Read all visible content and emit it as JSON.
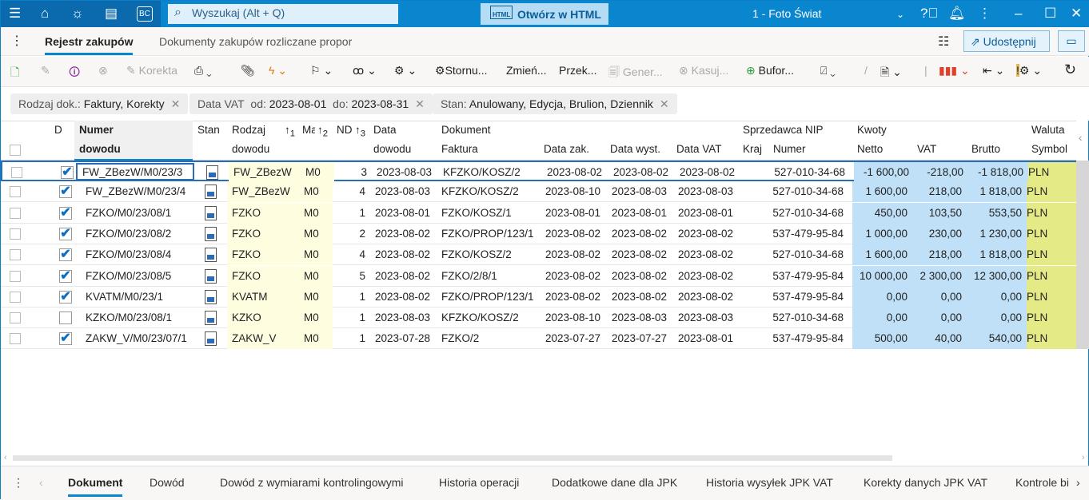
{
  "topbar": {
    "search_placeholder": "Wyszukaj (Alt + Q)",
    "open_html": "Otwórz w HTML",
    "company": "1 - Foto Świat",
    "bc": "BC"
  },
  "tabs": {
    "active": "Rejestr zakupów",
    "second": "Dokumenty zakupów rozliczane propor",
    "share": "Udostępnij"
  },
  "toolbar": {
    "korekta": "Korekta",
    "stornu": "Stornu...",
    "zmien": "Zmień...",
    "przek": "Przek...",
    "gener": "Gener...",
    "kasuj": "Kasuj...",
    "bufor": "Bufor..."
  },
  "filters": [
    {
      "label": "Rodzaj dok.:",
      "value": "Faktury, Korekty"
    },
    {
      "label": "Data VAT",
      "od_label": "od:",
      "od": "2023-08-01",
      "do_label": "do:",
      "do": "2023-08-31"
    },
    {
      "label": "Stan:",
      "value": "Anulowany, Edycja, Brulion, Dziennik"
    }
  ],
  "columns": {
    "d": "D",
    "numer1": "Numer",
    "numer2": "dowodu",
    "stan": "Stan",
    "rodzaj1": "Rodzaj",
    "rodzaj2": "dowodu",
    "ma": "Ma",
    "nd": "ND",
    "data1": "Data",
    "data2": "dowodu",
    "dokument": "Dokument",
    "faktura": "Faktura",
    "data_zak": "Data zak.",
    "data_wyst": "Data wyst.",
    "data_vat": "Data VAT",
    "sprzedawca": "Sprzedawca NIP",
    "kraj": "Kraj",
    "nip": "Numer",
    "kwoty": "Kwoty",
    "netto": "Netto",
    "vat": "VAT",
    "brutto": "Brutto",
    "waluta": "Waluta",
    "symbol": "Symbol",
    "sort1": "1",
    "sort2": "2",
    "sort3": "3"
  },
  "rows": [
    {
      "d": true,
      "numer": "FW_ZBezW/M0/23/3",
      "rodzaj": "FW_ZBezW",
      "ma": "M0",
      "nd": "3",
      "data": "2023-08-03",
      "faktura": "KFZKO/KOSZ/2",
      "zak": "2023-08-02",
      "wyst": "2023-08-02",
      "vat_date": "2023-08-02",
      "kraj": "",
      "nip": "527-010-34-68",
      "netto": "-1 600,00",
      "vat": "-218,00",
      "brutto": "-1 818,00",
      "waluta": "PLN"
    },
    {
      "d": true,
      "numer": "FW_ZBezW/M0/23/4",
      "rodzaj": "FW_ZBezW",
      "ma": "M0",
      "nd": "4",
      "data": "2023-08-03",
      "faktura": "KFZKO/KOSZ/2",
      "zak": "2023-08-10",
      "wyst": "2023-08-03",
      "vat_date": "2023-08-03",
      "kraj": "",
      "nip": "527-010-34-68",
      "netto": "1 600,00",
      "vat": "218,00",
      "brutto": "1 818,00",
      "waluta": "PLN"
    },
    {
      "d": true,
      "numer": "FZKO/M0/23/08/1",
      "rodzaj": "FZKO",
      "ma": "M0",
      "nd": "1",
      "data": "2023-08-01",
      "faktura": "FZKO/KOSZ/1",
      "zak": "2023-08-01",
      "wyst": "2023-08-01",
      "vat_date": "2023-08-01",
      "kraj": "",
      "nip": "527-010-34-68",
      "netto": "450,00",
      "vat": "103,50",
      "brutto": "553,50",
      "waluta": "PLN"
    },
    {
      "d": true,
      "numer": "FZKO/M0/23/08/2",
      "rodzaj": "FZKO",
      "ma": "M0",
      "nd": "2",
      "data": "2023-08-02",
      "faktura": "FZKO/PROP/123/1",
      "zak": "2023-08-02",
      "wyst": "2023-08-02",
      "vat_date": "2023-08-02",
      "kraj": "",
      "nip": "537-479-95-84",
      "netto": "1 000,00",
      "vat": "230,00",
      "brutto": "1 230,00",
      "waluta": "PLN"
    },
    {
      "d": true,
      "numer": "FZKO/M0/23/08/4",
      "rodzaj": "FZKO",
      "ma": "M0",
      "nd": "4",
      "data": "2023-08-02",
      "faktura": "FZKO/KOSZ/2",
      "zak": "2023-08-02",
      "wyst": "2023-08-02",
      "vat_date": "2023-08-02",
      "kraj": "",
      "nip": "527-010-34-68",
      "netto": "1 600,00",
      "vat": "218,00",
      "brutto": "1 818,00",
      "waluta": "PLN"
    },
    {
      "d": true,
      "numer": "FZKO/M0/23/08/5",
      "rodzaj": "FZKO",
      "ma": "M0",
      "nd": "5",
      "data": "2023-08-02",
      "faktura": "FZKO/2/8/1",
      "zak": "2023-08-02",
      "wyst": "2023-08-02",
      "vat_date": "2023-08-02",
      "kraj": "",
      "nip": "537-479-95-84",
      "netto": "10 000,00",
      "vat": "2 300,00",
      "brutto": "12 300,00",
      "waluta": "PLN"
    },
    {
      "d": true,
      "numer": "KVATM/M0/23/1",
      "rodzaj": "KVATM",
      "ma": "M0",
      "nd": "1",
      "data": "2023-08-02",
      "faktura": "FZKO/PROP/123/1",
      "zak": "2023-08-02",
      "wyst": "2023-08-02",
      "vat_date": "2023-08-02",
      "kraj": "",
      "nip": "537-479-95-84",
      "netto": "0,00",
      "vat": "0,00",
      "brutto": "0,00",
      "waluta": "PLN"
    },
    {
      "d": false,
      "numer": "KZKO/M0/23/08/1",
      "rodzaj": "KZKO",
      "ma": "M0",
      "nd": "1",
      "data": "2023-08-03",
      "faktura": "KFZKO/KOSZ/2",
      "zak": "2023-08-10",
      "wyst": "2023-08-03",
      "vat_date": "2023-08-03",
      "kraj": "",
      "nip": "527-010-34-68",
      "netto": "0,00",
      "vat": "0,00",
      "brutto": "0,00",
      "waluta": "PLN"
    },
    {
      "d": true,
      "numer": "ZAKW_V/M0/23/07/1",
      "rodzaj": "ZAKW_V",
      "ma": "M0",
      "nd": "1",
      "data": "2023-07-28",
      "faktura": "FZKO/2",
      "zak": "2023-07-27",
      "wyst": "2023-07-27",
      "vat_date": "2023-08-01",
      "kraj": "",
      "nip": "537-479-95-84",
      "netto": "500,00",
      "vat": "40,00",
      "brutto": "540,00",
      "waluta": "PLN"
    }
  ],
  "bottom_tabs": [
    "Dokument",
    "Dowód",
    "Dowód z wymiarami kontrolingowymi",
    "Historia operacji",
    "Dodatkowe dane dla JPK",
    "Historia wysyłek JPK VAT",
    "Korekty danych JPK VAT",
    "Kontrole bi"
  ],
  "colors": {
    "brand": "#0a86cf",
    "amounts_bg": "#bfe0f7",
    "currency_bg": "#e3ea86",
    "type_bg": "#fffde0"
  }
}
